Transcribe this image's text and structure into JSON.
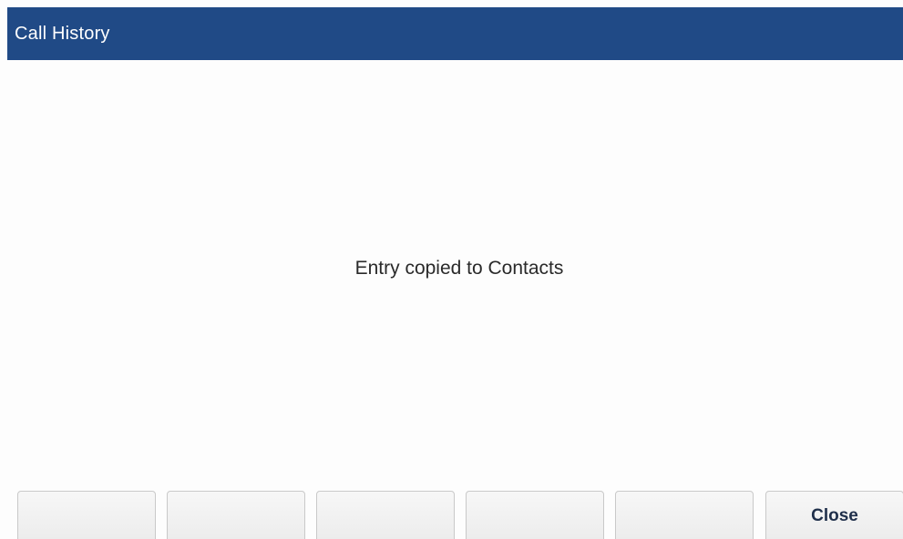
{
  "title_bar": {
    "title": "Call History",
    "color": "#204a86"
  },
  "message": {
    "text": "Entry copied to Contacts"
  },
  "softkeys": [
    {
      "label": ""
    },
    {
      "label": ""
    },
    {
      "label": ""
    },
    {
      "label": ""
    },
    {
      "label": ""
    },
    {
      "label": "Close"
    }
  ]
}
